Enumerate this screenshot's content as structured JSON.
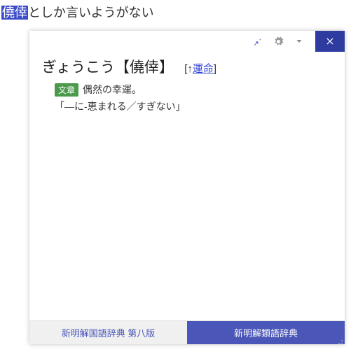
{
  "sentence": {
    "highlighted": "僥倖",
    "rest": "としか言いようがない"
  },
  "popup": {
    "headword_reading": "ぎょうこう",
    "headword_kanji": "【僥倖】",
    "ref_prefix": "[↑",
    "ref_link": "運命",
    "ref_suffix": "]",
    "tag": "文章",
    "definition": "偶然の幸運。",
    "example": "「―に-恵まれる／すぎない」",
    "tabs": {
      "inactive": "新明解国語辞典 第八版",
      "active": "新明解類語辞典"
    }
  }
}
